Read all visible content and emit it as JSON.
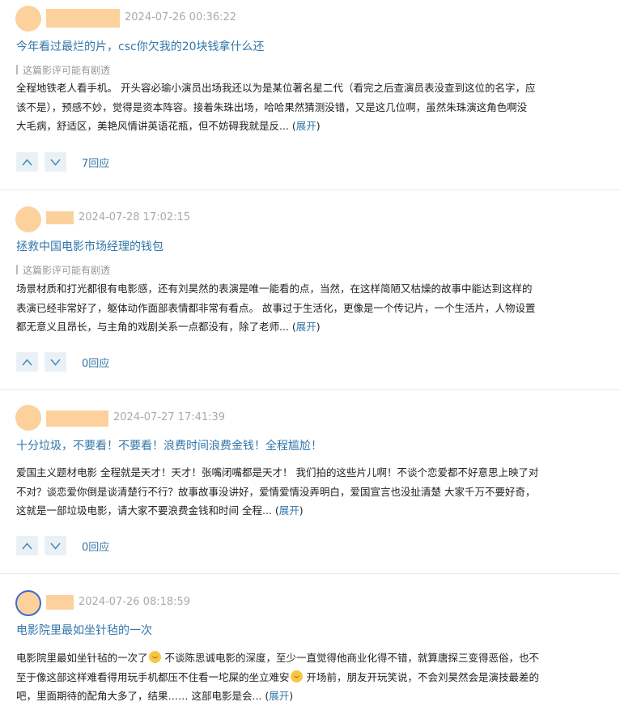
{
  "reviews": [
    {
      "time": "2024-07-26 00:36:22",
      "title": "今年看过最烂的片，csc你欠我的20块钱拿什么还",
      "spoiler": "这篇影评可能有剧透",
      "lines": [
        "全程地铁老人看手机。 开头容必瑜小演员出场我还以为是某位著名星二代（看完之后查演员表没查到这位的名字，应",
        "该不是），预感不妙，觉得是资本阵容。接着朱珠出场，哈哈果然猜测没错，又是这几位啊，虽然朱珠演这角色啊没",
        "大毛病，舒适区，美艳风情讲英语花瓶，但不妨碍我就是反..."
      ],
      "expand": "展开",
      "replies": "7回应"
    },
    {
      "time": "2024-07-28 17:02:15",
      "title": "拯救中国电影市场经理的钱包",
      "spoiler": "这篇影评可能有剧透",
      "lines": [
        "场景材质和打光都很有电影感，还有刘昊然的表演是唯一能看的点，当然，在这样简陋又枯燥的故事中能达到这样的",
        "表演已经非常好了，躯体动作面部表情都非常有看点。 故事过于生活化，更像是一个传记片，一个生活片，人物设置",
        "都无意义且昂长，与主角的戏剧关系一点都没有，除了老师..."
      ],
      "expand": "展开",
      "replies": "0回应"
    },
    {
      "time": "2024-07-27 17:41:39",
      "title": "十分垃圾，不要看！不要看！浪费时间浪费金钱！全程尴尬！",
      "lines": [
        "爱国主义题材电影 全程就是天才！天才！张嘴闭嘴都是天才！ 我们拍的这些片儿啊！不谈个恋爱都不好意思上映了对",
        "不对？谈恋爱你倒是谈清楚行不行？故事故事没讲好，爱情爱情没弄明白，爱国宣言也没扯清楚 大家千万不要好奇，",
        "这就是一部垃圾电影，请大家不要浪费金钱和时间 全程..."
      ],
      "expand": "展开",
      "replies": "0回应"
    },
    {
      "time": "2024-07-26 08:18:59",
      "title": "电影院里最如坐针毡的一次",
      "line1a": "电影院里最如坐针毡的一次了",
      "line1b": " 不谈陈思诚电影的深度，至少一直觉得他商业化得不错，就算唐探三变得恶俗，也不",
      "line2a": "至于像这部这样难看得用玩手机都压不住看一坨屎的坐立难安",
      "line2b": " 开场前，朋友开玩笑说，不会刘昊然会是演技最差的",
      "line3": "吧，里面期待的配角大多了，结果…… 这部电影是会...",
      "expand": "展开"
    }
  ],
  "icons": {
    "up": "upvote-icon",
    "down": "downvote-icon",
    "emoji": "emoji-icon"
  }
}
